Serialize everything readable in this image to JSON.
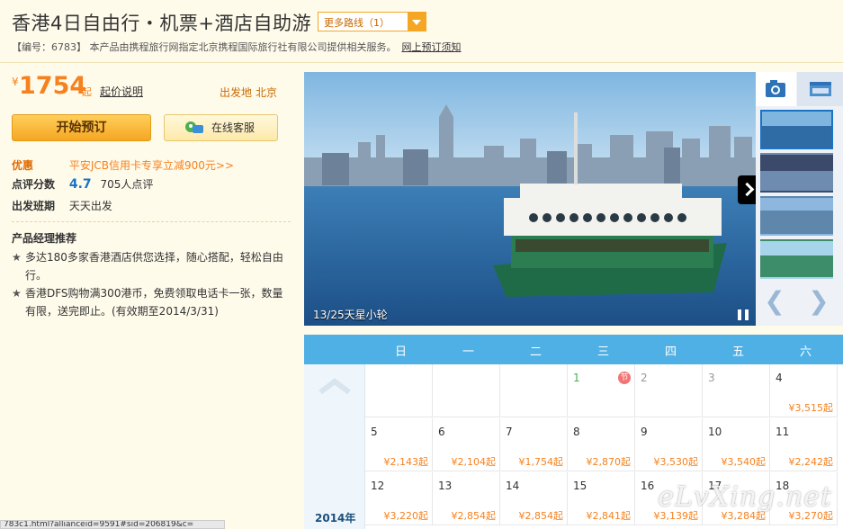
{
  "header": {
    "title": "香港4日自由行・机票+酒店自助游",
    "route_select": "更多路线（1）",
    "subline": "【编号：6783】 本产品由携程旅行网指定北京携程国际旅行社有限公司提供相关服务。",
    "notice_link": "网上预订须知"
  },
  "price": {
    "currency": "¥",
    "amount": "1754",
    "suffix": "起",
    "note_link": "起价说明",
    "depart_label": "出发地",
    "depart_city": "北京"
  },
  "buttons": {
    "book": "开始预订",
    "service": "在线客服"
  },
  "info": {
    "promo_label": "优惠",
    "promo_text": "平安JCB信用卡专享立减900元>>",
    "score_label": "点评分数",
    "score": "4.7",
    "reviews": "705人点评",
    "schedule_label": "出发班期",
    "schedule": "天天出发"
  },
  "recommend": {
    "title": "产品经理推荐",
    "items": [
      "多达180多家香港酒店供您选择，随心搭配，轻松自由行。",
      "香港DFS购物满300港币，免费领取电话卡一张，数量有限，送完即止。(有效期至2014/3/31)"
    ]
  },
  "gallery": {
    "caption": "13/25天星小轮",
    "colors": {
      "sky": "#9ecbe8",
      "water": "#2f6ca6"
    }
  },
  "calendar": {
    "weekdays": [
      "日",
      "一",
      "二",
      "三",
      "四",
      "五",
      "六"
    ],
    "year": "2014年",
    "festival_badge": "节",
    "rows": [
      [
        {
          "num": "",
          "price": ""
        },
        {
          "num": "",
          "price": ""
        },
        {
          "num": "",
          "price": ""
        },
        {
          "num": "1",
          "price": "",
          "style": "green",
          "festival": true
        },
        {
          "num": "2",
          "price": "",
          "style": "grey"
        },
        {
          "num": "3",
          "price": "",
          "style": "grey"
        },
        {
          "num": "4",
          "price": "¥3,515起"
        }
      ],
      [
        {
          "num": "5",
          "price": "¥2,143起"
        },
        {
          "num": "6",
          "price": "¥2,104起"
        },
        {
          "num": "7",
          "price": "¥1,754起"
        },
        {
          "num": "8",
          "price": "¥2,870起"
        },
        {
          "num": "9",
          "price": "¥3,530起"
        },
        {
          "num": "10",
          "price": "¥3,540起"
        },
        {
          "num": "11",
          "price": "¥2,242起"
        }
      ],
      [
        {
          "num": "12",
          "price": "¥3,220起"
        },
        {
          "num": "13",
          "price": "¥2,854起"
        },
        {
          "num": "14",
          "price": "¥2,854起"
        },
        {
          "num": "15",
          "price": "¥2,841起"
        },
        {
          "num": "16",
          "price": "¥3,139起"
        },
        {
          "num": "17",
          "price": "¥3,284起"
        },
        {
          "num": "18",
          "price": "¥3,270起"
        }
      ]
    ]
  },
  "status_url": "783c1.html?allianceid=9591#sid=206819&c=",
  "watermark": "eLvXing.net"
}
